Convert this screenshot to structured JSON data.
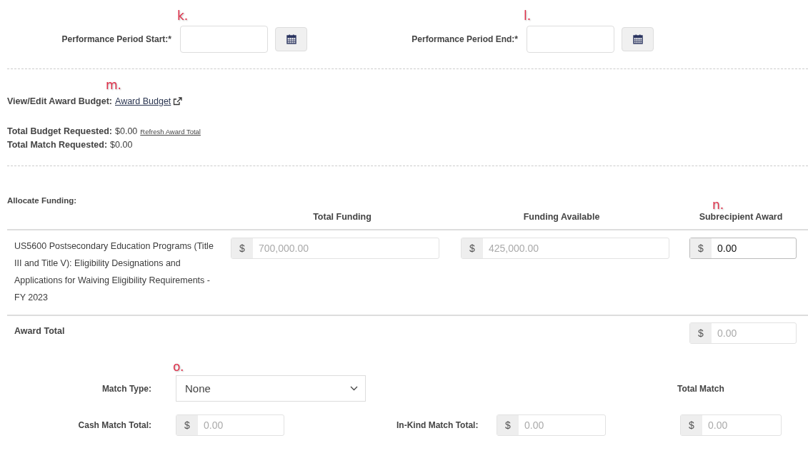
{
  "period": [
    {
      "marker": "k.",
      "label": "Performance Period Start:*"
    },
    {
      "marker": "l.",
      "label": "Performance Period End:*"
    }
  ],
  "budget": {
    "marker": "m.",
    "label": "View/Edit Award Budget:",
    "link": "Award Budget"
  },
  "totals": [
    {
      "label": "Total Budget Requested:",
      "value": "$0.00",
      "link": "Refresh Award Total"
    },
    {
      "label": "Total Match Requested:",
      "value": "$0.00"
    }
  ],
  "allocate": {
    "title": "Allocate Funding:",
    "columns": [
      {
        "label": "Total Funding"
      },
      {
        "label": "Funding Available"
      },
      {
        "label": "Subrecipient Award",
        "marker": "n."
      }
    ],
    "rows": [
      {
        "name": "US5600 Postsecondary Education Programs (Title III and Title V): Eligibility Designations and Applications for Waiving Eligibility Requirements - FY 2023",
        "cells": [
          {
            "prefix": "$",
            "value": "700,000.00",
            "disabled": true
          },
          {
            "prefix": "$",
            "value": "425,000.00",
            "disabled": true
          },
          {
            "prefix": "$",
            "value": "0.00",
            "disabled": false
          }
        ]
      }
    ],
    "award_total": {
      "label": "Award Total",
      "prefix": "$",
      "value": "0.00",
      "disabled": true
    }
  },
  "match": {
    "marker": "o.",
    "type_label": "Match Type:",
    "type_value": "None",
    "total_header": "Total Match",
    "cash": {
      "label": "Cash Match Total:",
      "prefix": "$",
      "value": "0.00",
      "disabled": true
    },
    "inkind": {
      "label": "In-Kind Match Total:",
      "prefix": "$",
      "value": "0.00",
      "disabled": true
    },
    "total": {
      "prefix": "$",
      "value": "0.00",
      "disabled": true
    }
  }
}
